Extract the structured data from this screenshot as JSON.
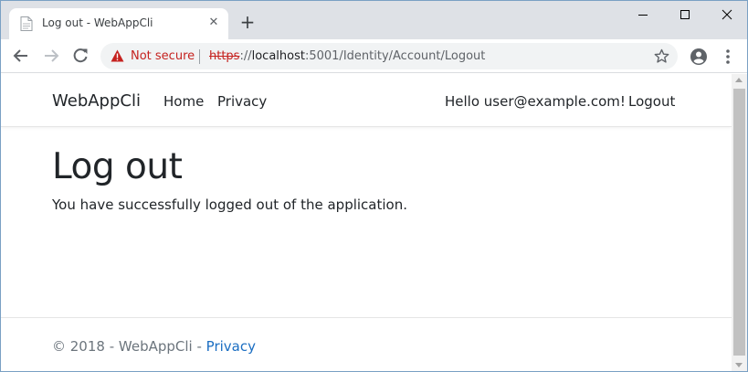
{
  "browser": {
    "tab": {
      "title": "Log out - WebAppCli",
      "favicon": "page-icon",
      "close_icon": "close-icon"
    },
    "new_tab_icon": "plus-icon",
    "window_controls": [
      "minimize-icon",
      "maximize-icon",
      "close-icon"
    ],
    "toolbar": {
      "back_icon": "back-arrow-icon",
      "forward_icon": "forward-arrow-icon",
      "reload_icon": "reload-icon",
      "security_icon": "warning-icon",
      "security_label": "Not secure",
      "url_scheme": "https",
      "url_sep": "://",
      "url_host": "localhost",
      "url_rest": ":5001/Identity/Account/Logout",
      "bookmark_icon": "star-icon",
      "profile_icon": "account-circle-icon",
      "menu_icon": "more-vert-icon"
    }
  },
  "page": {
    "navbar": {
      "brand": "WebAppCli",
      "links": [
        "Home",
        "Privacy"
      ],
      "greeting": "Hello user@example.com!",
      "logout": "Logout"
    },
    "heading": "Log out",
    "message": "You have successfully logged out of the application.",
    "footer": {
      "text": "© 2018 - WebAppCli - ",
      "link": "Privacy"
    }
  },
  "colors": {
    "warning_red": "#c5221f",
    "link_blue": "#1b6ec2",
    "tabstrip_bg": "#dee1e6",
    "omnibox_bg": "#f1f3f4"
  }
}
